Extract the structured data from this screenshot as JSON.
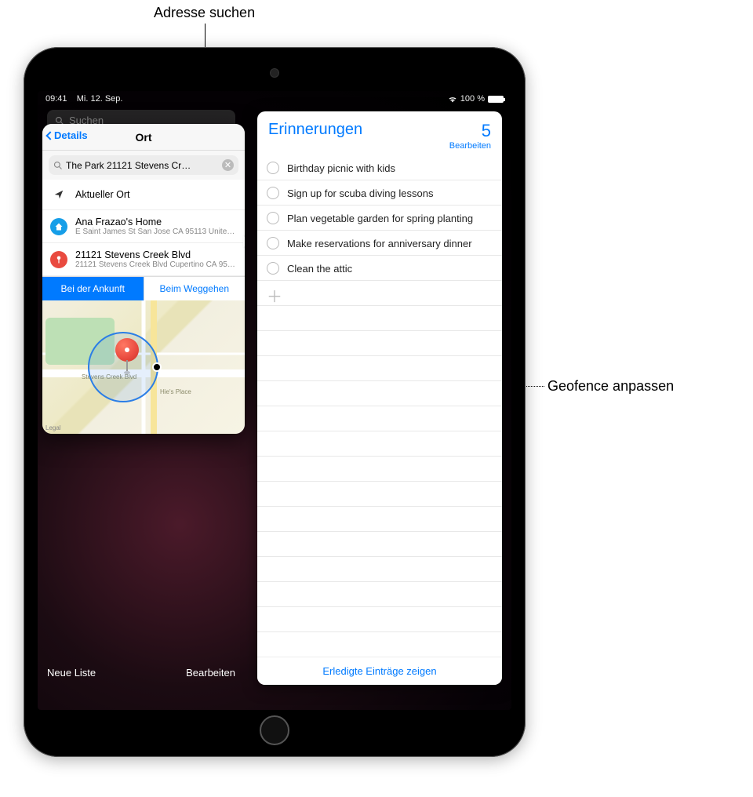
{
  "callouts": {
    "top": "Adresse suchen",
    "right": "Geofence anpassen"
  },
  "statusbar": {
    "time": "09:41",
    "date": "Mi. 12. Sep.",
    "battery": "100 %"
  },
  "left_panel": {
    "search_placeholder": "Suchen",
    "new_list": "Neue Liste",
    "edit": "Bearbeiten"
  },
  "popover": {
    "back": "Details",
    "title": "Ort",
    "query": "The Park  21121 Stevens Cr…",
    "items": [
      {
        "kind": "current",
        "title": "Aktueller Ort",
        "sub": ""
      },
      {
        "kind": "home",
        "title": "Ana Frazao's Home",
        "sub": "E Saint James St San Jose CA 95113 United S…"
      },
      {
        "kind": "pin",
        "title": "21121 Stevens Creek Blvd",
        "sub": "21121 Stevens Creek Blvd Cupertino CA 9501…"
      }
    ],
    "segment": {
      "arrive": "Bei der Ankunft",
      "leave": "Beim Weggehen",
      "active": "arrive"
    },
    "map": {
      "legal": "Legal",
      "street_label": "Stevens Creek Blvd",
      "side_label": "Hie's Place"
    }
  },
  "reminders": {
    "title": "Erinnerungen",
    "count": "5",
    "edit": "Bearbeiten",
    "items": [
      "Birthday picnic with kids",
      "Sign up for scuba diving lessons",
      "Plan vegetable garden for spring planting",
      "Make reservations for anniversary dinner",
      "Clean the attic"
    ],
    "footer": "Erledigte Einträge zeigen"
  }
}
